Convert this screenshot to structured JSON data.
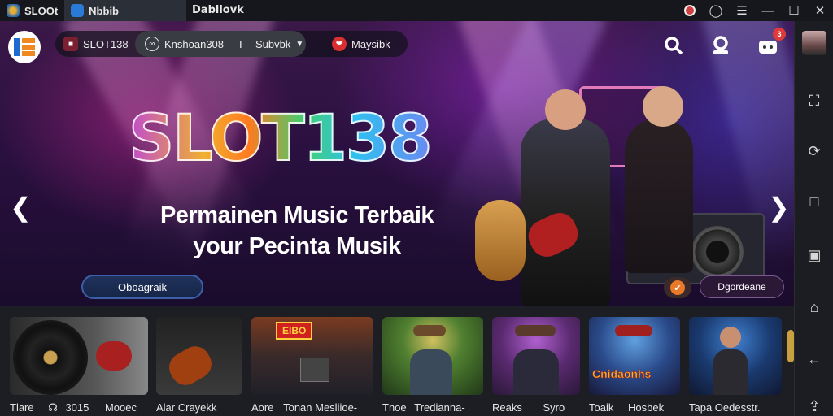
{
  "browser": {
    "tabs": [
      {
        "label": "SLOOt"
      },
      {
        "label": "Nbbib"
      }
    ],
    "page_title": "Dabllovk"
  },
  "hero": {
    "nav": {
      "brand_chip": "SLOT138",
      "search_chip": "Knshoan308",
      "separator": "I",
      "dropdown_label": "Subvbk",
      "favorite_chip": "Maysibk"
    },
    "notification_count": "3",
    "brand_title": "SLOT138",
    "tagline_line1": "Permainen Music Terbaik",
    "tagline_line2": "your Pecinta Musik",
    "cta_left": "Oboagraik",
    "cta_right": "Dgordeane"
  },
  "strip": {
    "cards": [
      {
        "caption_a": "Tlare",
        "caption_b": "3015",
        "caption_c": "Mooec"
      },
      {
        "caption_a": "Alar Crayekk"
      },
      {
        "caption_a": "Aore",
        "caption_b": "Tonan Mesliioe-",
        "banner": "EIBO"
      },
      {
        "caption_a": "Tnoe",
        "caption_b": "Tredianna-"
      },
      {
        "caption_a": "Reaks",
        "caption_b": "Syro"
      },
      {
        "caption_a": "Toaik",
        "caption_b": "Hosbek",
        "banner": "Cnidaonhs"
      },
      {
        "caption_a": "Tapa Oedesstr."
      }
    ]
  }
}
